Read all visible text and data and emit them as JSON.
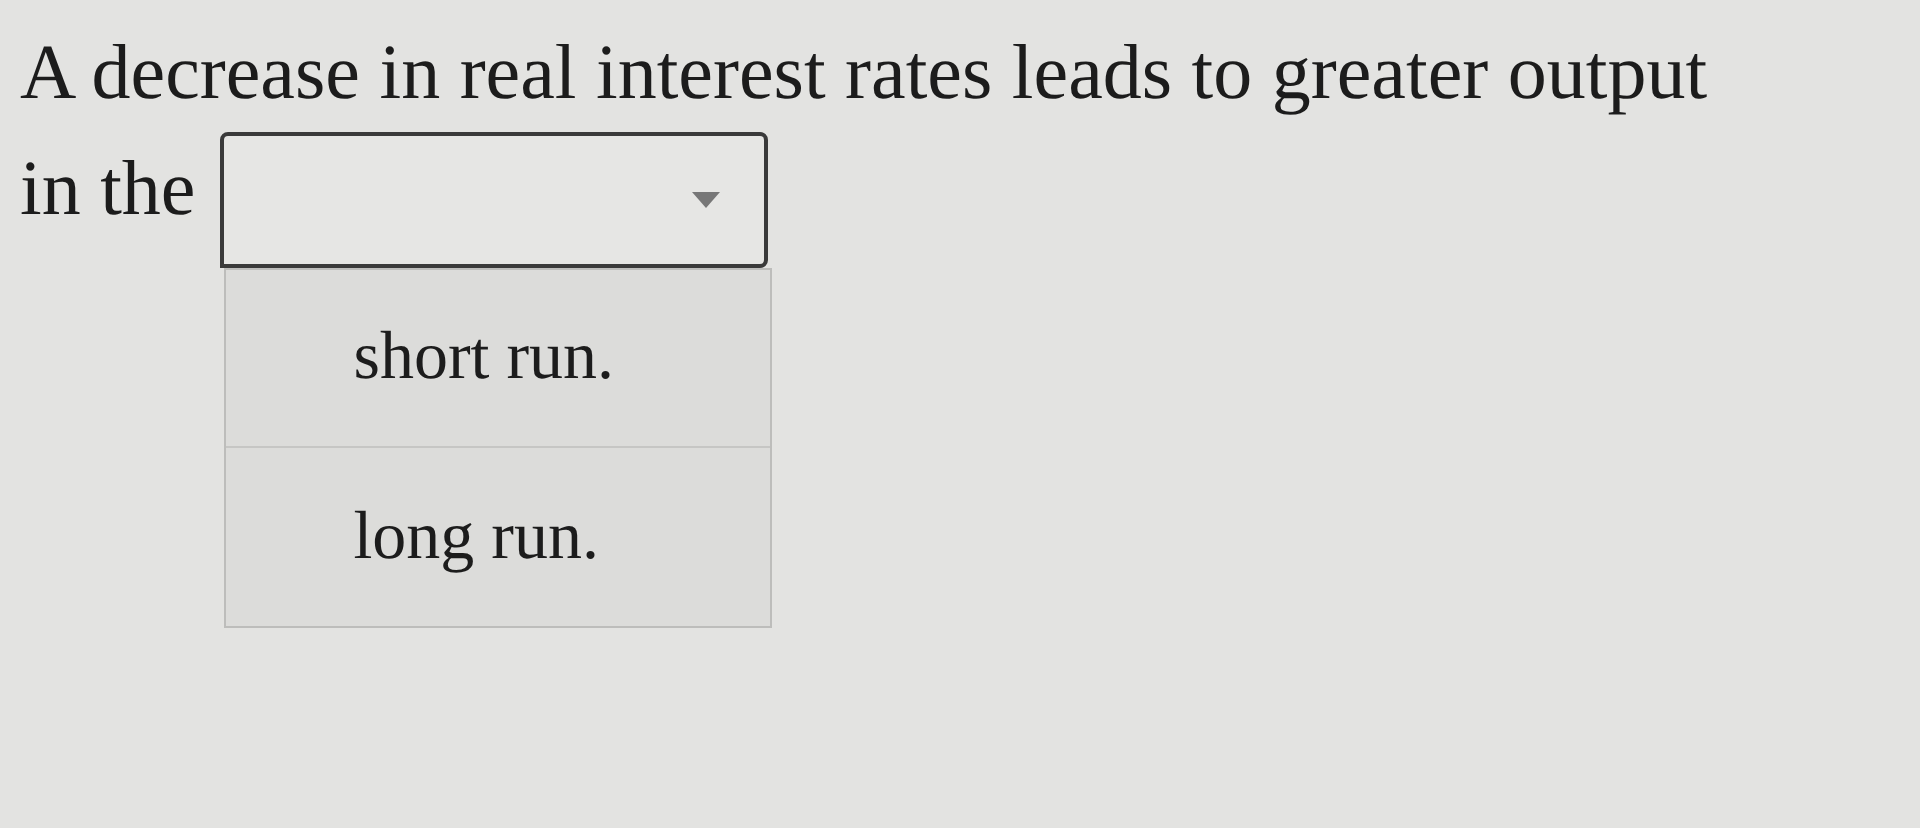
{
  "question": {
    "lines": [
      "A decrease in real interest rates leads to greater output",
      "in the"
    ]
  },
  "dropdown": {
    "expanded": true
  },
  "options": [
    {
      "label": "short run.",
      "selected": false
    },
    {
      "label": "long run.",
      "selected": false
    }
  ]
}
